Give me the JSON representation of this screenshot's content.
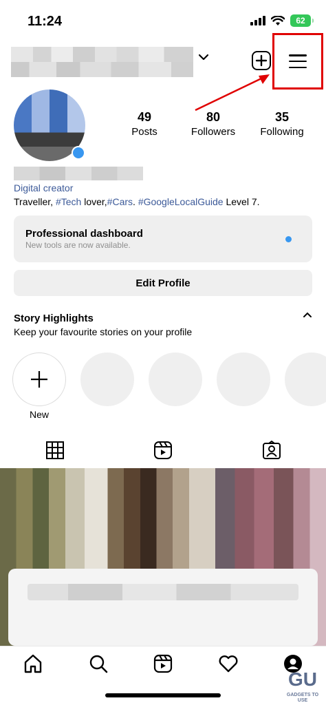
{
  "status_bar": {
    "time": "11:24",
    "battery": "62"
  },
  "profile": {
    "posts_count": "49",
    "posts_label": "Posts",
    "followers_count": "80",
    "followers_label": "Followers",
    "following_count": "35",
    "following_label": "Following",
    "category": "Digital creator",
    "bio_prefix": "Traveller, ",
    "bio_tag1": "#Tech",
    "bio_mid1": " lover,",
    "bio_tag2": "#Cars",
    "bio_mid2": ". ",
    "bio_tag3": "#GoogleLocalGuide",
    "bio_suffix": " Level 7."
  },
  "dashboard": {
    "title": "Professional dashboard",
    "subtitle": "New tools are now available."
  },
  "edit_profile_label": "Edit Profile",
  "highlights": {
    "title": "Story Highlights",
    "subtitle": "Keep your favourite stories on your profile",
    "new_label": "New"
  },
  "watermark": {
    "logo": "GU",
    "caption": "GADGETS TO USE"
  },
  "icons": [
    "wifi-icon",
    "signal-icon",
    "add-post-icon",
    "menu-icon",
    "grid-icon",
    "reels-icon",
    "tagged-icon",
    "home-icon",
    "search-icon",
    "reels-nav-icon",
    "heart-icon",
    "profile-icon"
  ],
  "colors": {
    "link": "#3b5998",
    "badge": "#3897f0",
    "highlight_box": "#e00000",
    "battery": "#34c759"
  }
}
